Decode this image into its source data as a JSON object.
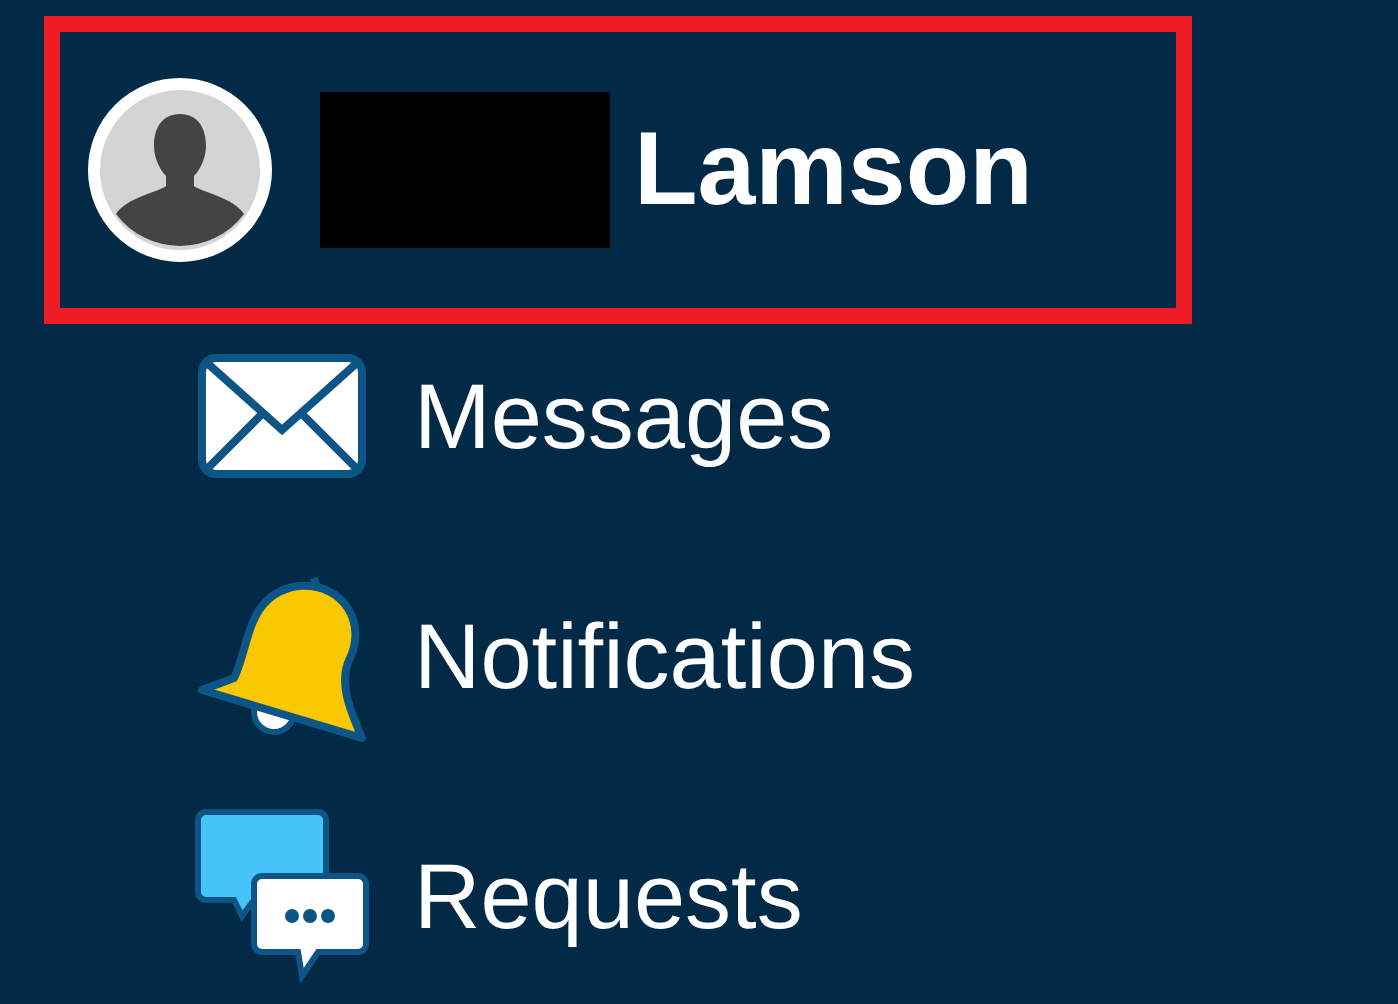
{
  "profile": {
    "name": "Lamson",
    "name_redacted": true,
    "highlighted": true
  },
  "menu": [
    {
      "kind": "messages",
      "label": "Messages"
    },
    {
      "kind": "notifications",
      "label": "Notifications"
    },
    {
      "kind": "requests",
      "label": "Requests"
    }
  ]
}
